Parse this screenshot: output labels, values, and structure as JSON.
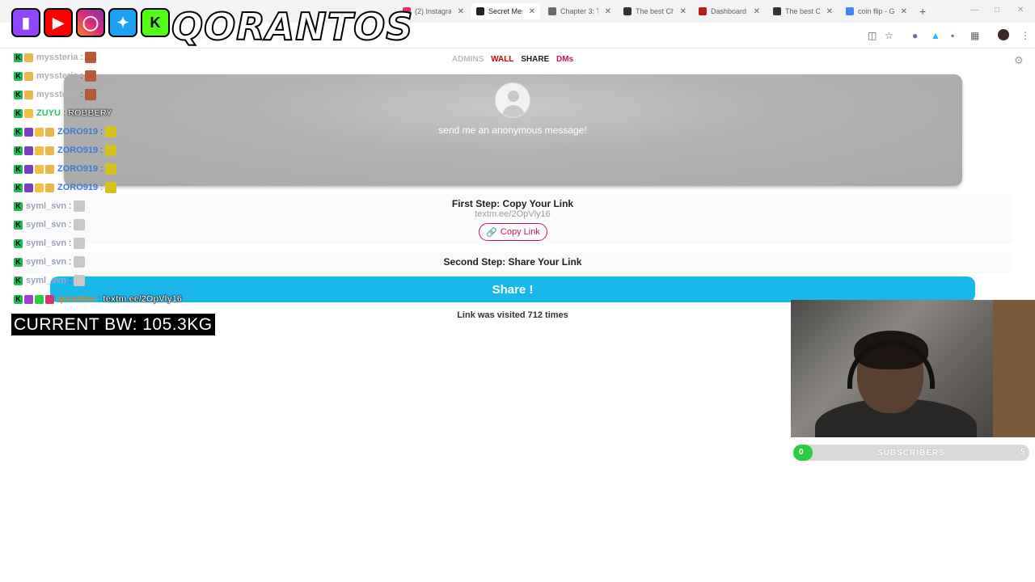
{
  "browser": {
    "tabs": [
      {
        "label": "(2) Instagram",
        "active": false
      },
      {
        "label": "Secret Mess",
        "active": true
      },
      {
        "label": "Chapter 3: T",
        "active": false
      },
      {
        "label": "The best Ch",
        "active": false
      },
      {
        "label": "Dashboard",
        "active": false
      },
      {
        "label": "The best Ch",
        "active": false
      },
      {
        "label": "coin flip - G",
        "active": false
      }
    ],
    "new_tab": "+"
  },
  "overlay": {
    "brand": "QORANTOS",
    "current_bw": "CURRENT BW: 105.3KG"
  },
  "page": {
    "nav": {
      "admins": "ADMINS",
      "wall": "WALL",
      "share": "SHARE",
      "dms": "DMs"
    },
    "hero_text": "send me an anonymous message!",
    "step1": {
      "title": "First Step: Copy Your Link",
      "link": "textm.ee/2OpVly16",
      "copy_label": "Copy Link"
    },
    "step2": {
      "title": "Second Step: Share Your Link",
      "share_label": "Share !"
    },
    "visited": "Link was visited 712 times"
  },
  "chat": [
    {
      "user": "myssteria",
      "color": "#b0b0b0",
      "badges": [
        "#1db954",
        "#e8b84a"
      ],
      "msg": "",
      "emote": "#b85a3a"
    },
    {
      "user": "myssteria",
      "color": "#b0b0b0",
      "badges": [
        "#1db954",
        "#e8b84a"
      ],
      "msg": "",
      "emote": "#b85a3a"
    },
    {
      "user": "myssteria",
      "color": "#b0b0b0",
      "badges": [
        "#1db954",
        "#e8b84a"
      ],
      "msg": "",
      "emote": "#b85a3a"
    },
    {
      "user": "ZUYU",
      "color": "#2fbf6f",
      "badges": [
        "#1db954",
        "#f0c040"
      ],
      "msg": "ROBBERY",
      "emote": ""
    },
    {
      "user": "ZORO919",
      "color": "#3a7bd5",
      "badges": [
        "#1db954",
        "#7b3fc4",
        "#f0c040",
        "#e8b84a"
      ],
      "msg": "",
      "emote": "#d6c21a"
    },
    {
      "user": "ZORO919",
      "color": "#3a7bd5",
      "badges": [
        "#1db954",
        "#7b3fc4",
        "#f0c040",
        "#e8b84a"
      ],
      "msg": "",
      "emote": "#d6c21a"
    },
    {
      "user": "ZORO919",
      "color": "#3a7bd5",
      "badges": [
        "#1db954",
        "#7b3fc4",
        "#f0c040",
        "#e8b84a"
      ],
      "msg": "",
      "emote": "#d6c21a"
    },
    {
      "user": "ZORO919",
      "color": "#3a7bd5",
      "badges": [
        "#1db954",
        "#7b3fc4",
        "#f0c040",
        "#e8b84a"
      ],
      "msg": "",
      "emote": "#d6c21a"
    },
    {
      "user": "syml_svn",
      "color": "#9aa6b8",
      "badges": [
        "#1db954"
      ],
      "msg": "",
      "emote": "#c8c8c8"
    },
    {
      "user": "syml_svn",
      "color": "#9aa6b8",
      "badges": [
        "#1db954"
      ],
      "msg": "",
      "emote": "#c8c8c8"
    },
    {
      "user": "syml_svn",
      "color": "#9aa6b8",
      "badges": [
        "#1db954"
      ],
      "msg": "",
      "emote": "#c8c8c8"
    },
    {
      "user": "syml_svn",
      "color": "#9aa6b8",
      "badges": [
        "#1db954"
      ],
      "msg": "",
      "emote": "#c8c8c8"
    },
    {
      "user": "syml_svn",
      "color": "#9aa6b8",
      "badges": [
        "#1db954"
      ],
      "msg": "",
      "emote": "#c8c8c8"
    },
    {
      "user": "qorantos",
      "color": "#e8841a",
      "badges": [
        "#1db954",
        "#9b3fd6",
        "#2ecc40",
        "#d6336c"
      ],
      "msg": "textm.ee/2OpVly16",
      "emote": ""
    }
  ],
  "subgoal": {
    "start": "0",
    "label": "SUBSCRIBERS",
    "end": "5",
    "progress": 0.06
  },
  "colors": {
    "wall": "#d50000",
    "dms": "#c2185b",
    "admins": "#bdbdbd",
    "share_button": "#1ab7ea",
    "goal_fill": "#2ecc40"
  }
}
